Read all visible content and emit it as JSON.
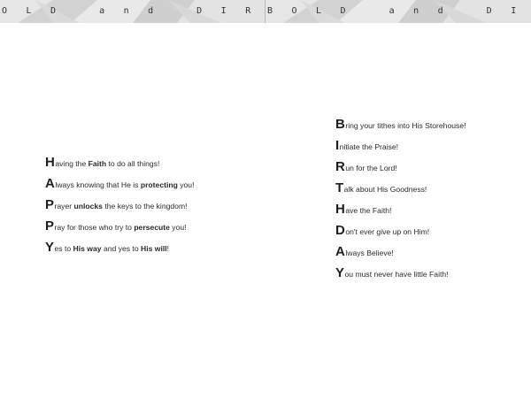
{
  "banner": {
    "left_text": "OLD and DIRECT",
    "right_text": "BOLD and DIREC"
  },
  "happy": [
    {
      "cap": "H",
      "parts": [
        [
          "aving the ",
          ""
        ],
        [
          "Faith",
          "b"
        ],
        [
          " to do all things!",
          ""
        ]
      ]
    },
    {
      "cap": "A",
      "parts": [
        [
          "lways knowing that He is ",
          ""
        ],
        [
          "protecting",
          "b"
        ],
        [
          " you!",
          ""
        ]
      ]
    },
    {
      "cap": "P",
      "parts": [
        [
          "rayer ",
          ""
        ],
        [
          "unlocks",
          "b"
        ],
        [
          " the keys to the kingdom!",
          ""
        ]
      ]
    },
    {
      "cap": "P",
      "parts": [
        [
          "ray for those who try to ",
          ""
        ],
        [
          "persecute",
          "b"
        ],
        [
          " you!",
          ""
        ]
      ]
    },
    {
      "cap": "Y",
      "parts": [
        [
          "es to ",
          ""
        ],
        [
          "His way",
          "b"
        ],
        [
          " and yes to ",
          ""
        ],
        [
          "His will",
          "b"
        ],
        [
          "!",
          ""
        ]
      ]
    }
  ],
  "birthday": [
    {
      "cap": "B",
      "parts": [
        [
          "ring your tithes into His Storehouse!",
          ""
        ]
      ]
    },
    {
      "cap": "I",
      "parts": [
        [
          "nitiate the Praise!",
          ""
        ]
      ]
    },
    {
      "cap": "R",
      "parts": [
        [
          "un for the Lord!",
          ""
        ]
      ]
    },
    {
      "cap": "T",
      "parts": [
        [
          "alk about His Goodness!",
          ""
        ]
      ]
    },
    {
      "cap": "H",
      "parts": [
        [
          "ave the Faith!",
          ""
        ]
      ]
    },
    {
      "cap": "D",
      "parts": [
        [
          "on't ever give up on Him!",
          ""
        ]
      ]
    },
    {
      "cap": "A",
      "parts": [
        [
          "lways Believe!",
          ""
        ]
      ]
    },
    {
      "cap": "Y",
      "parts": [
        [
          "ou must never have little Faith!",
          ""
        ]
      ]
    }
  ]
}
